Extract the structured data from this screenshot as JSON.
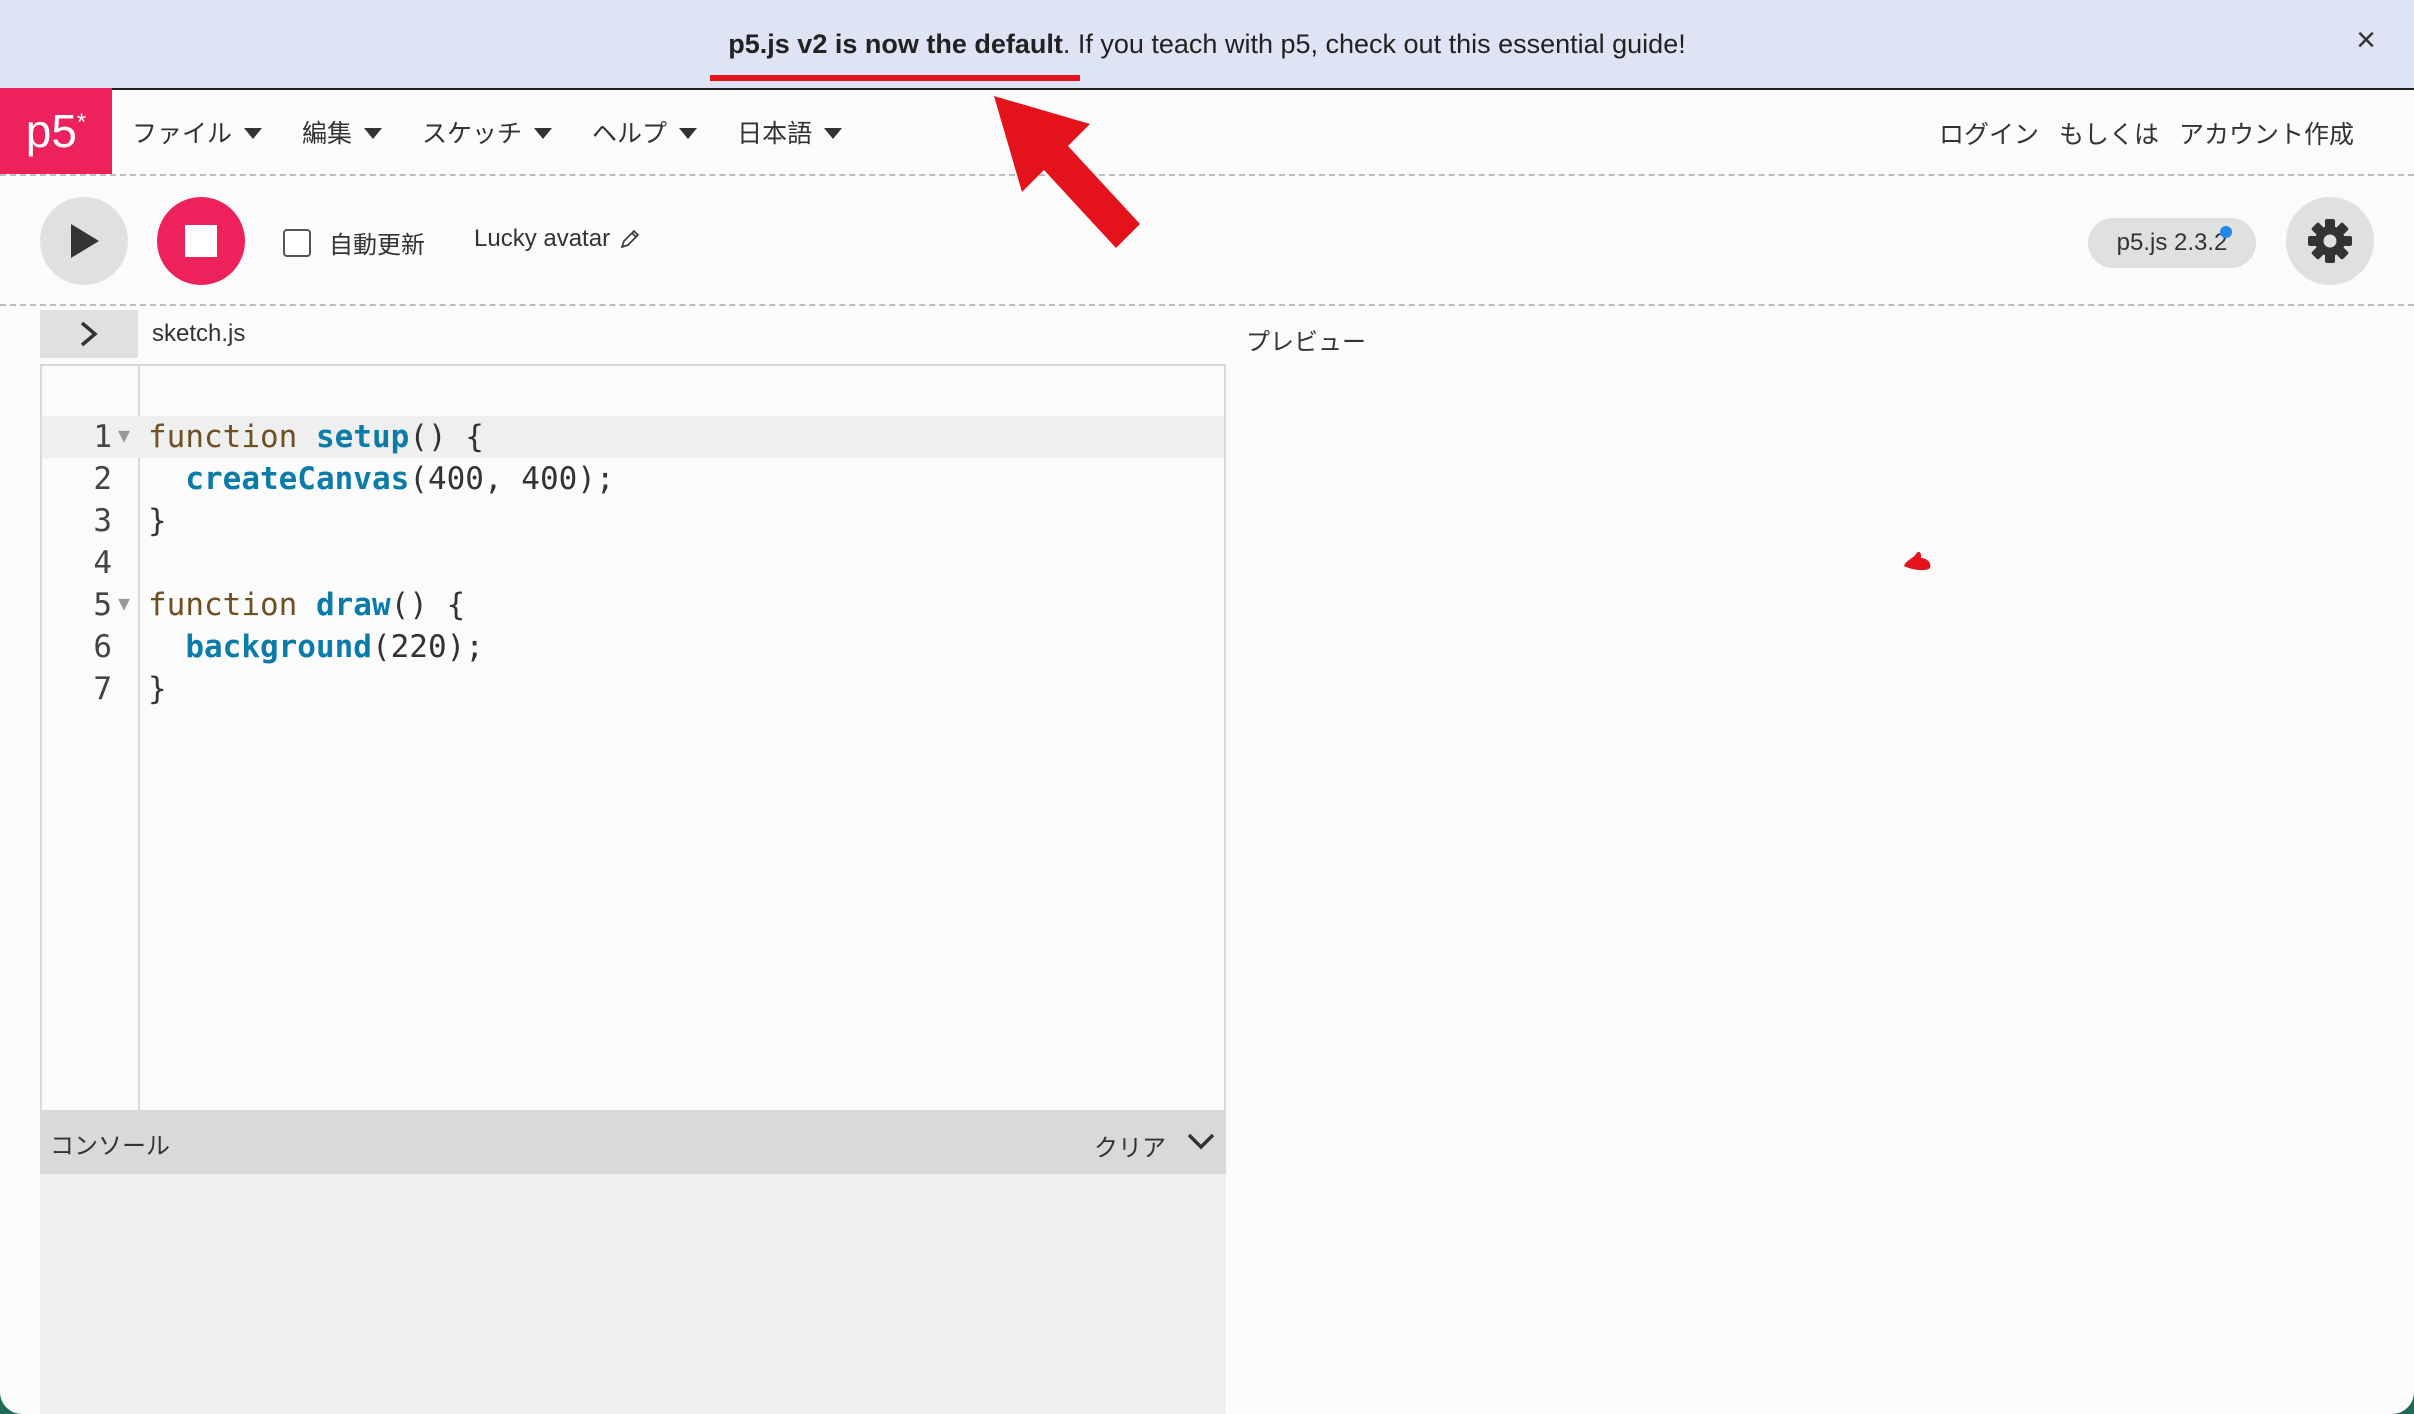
{
  "banner": {
    "bold_text": "p5.js v2 is now the default",
    "rest_text": ". If you teach with p5, check out this essential guide!",
    "close_label": "×"
  },
  "nav": {
    "logo": "p5",
    "logo_mark": "*",
    "menus": [
      {
        "label": "ファイル"
      },
      {
        "label": "編集"
      },
      {
        "label": "スケッチ"
      },
      {
        "label": "ヘルプ"
      },
      {
        "label": "日本語"
      }
    ],
    "auth": {
      "login": "ログイン",
      "or": "もしくは",
      "signup": "アカウント作成"
    }
  },
  "toolbar": {
    "autorefresh_label": "自動更新",
    "autorefresh_checked": false,
    "sketch_name": "Lucky avatar",
    "version": "p5.js 2.3.2"
  },
  "editor": {
    "file_tab": "sketch.js",
    "lines": [
      {
        "num": "1",
        "fold": true
      },
      {
        "num": "2",
        "fold": false
      },
      {
        "num": "3",
        "fold": false
      },
      {
        "num": "4",
        "fold": false
      },
      {
        "num": "5",
        "fold": true
      },
      {
        "num": "6",
        "fold": false
      },
      {
        "num": "7",
        "fold": false
      }
    ],
    "code": {
      "l1_kw": "function",
      "l1_fn": "setup",
      "l1_rest": "() {",
      "l2_fn": "createCanvas",
      "l2_rest": "(400, 400);",
      "l3": "}",
      "l5_kw": "function",
      "l5_fn": "draw",
      "l5_rest": "() {",
      "l6_fn": "background",
      "l6_rest": "(220);",
      "l7": "}"
    }
  },
  "console": {
    "label": "コンソール",
    "clear_label": "クリア"
  },
  "preview": {
    "label": "プレビュー"
  },
  "colors": {
    "accent": "#ed225d",
    "banner_bg": "#dfe4f4",
    "annotation": "#e4121a",
    "keyword": "#704f21",
    "function": "#0b7ca9"
  }
}
